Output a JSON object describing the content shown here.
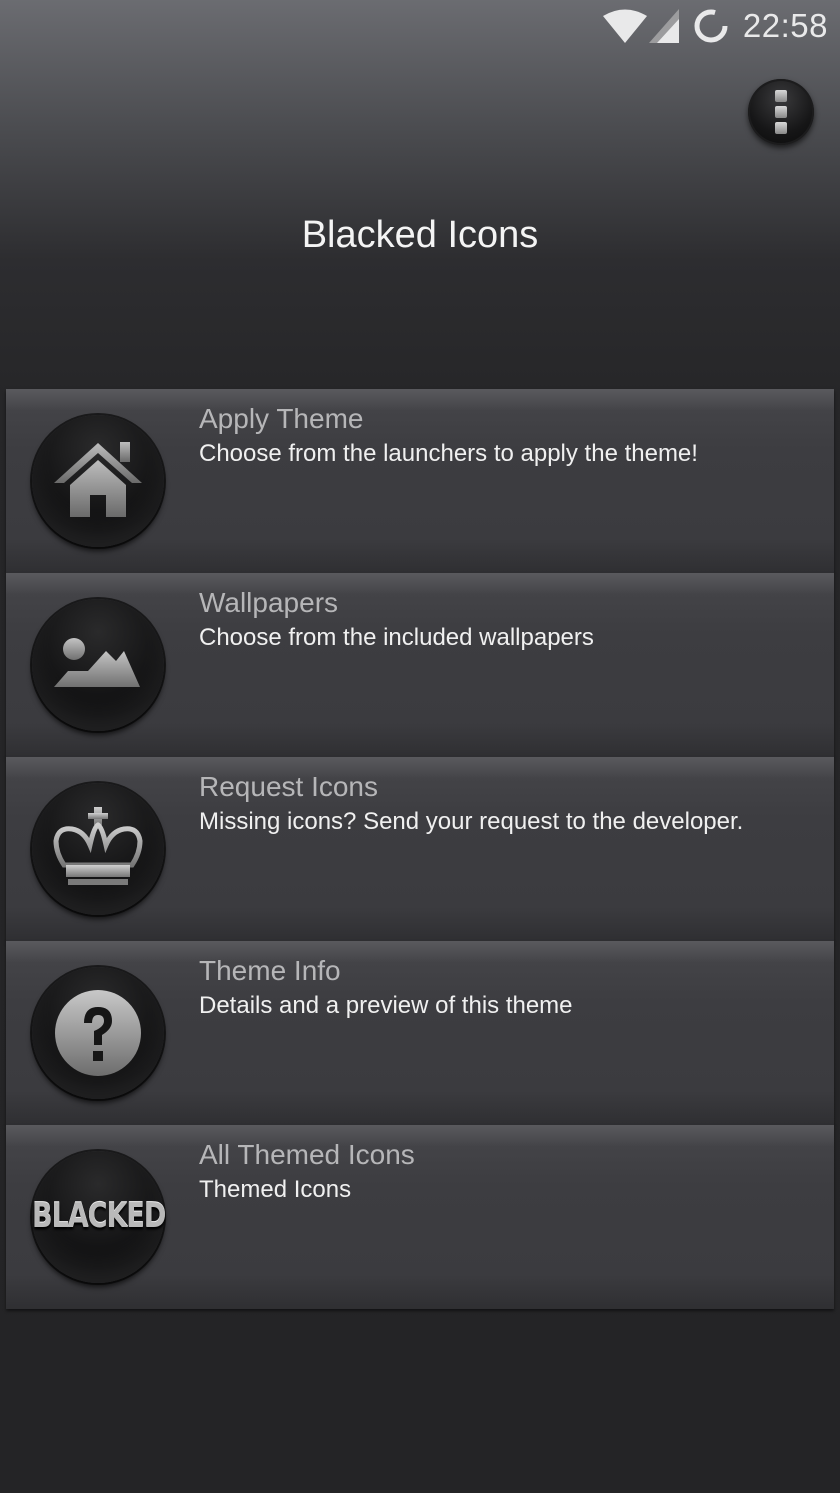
{
  "status_bar": {
    "time": "22:58",
    "icons": [
      "wifi-icon",
      "cellular-signal-icon",
      "sync-icon"
    ]
  },
  "header": {
    "title": "Blacked Icons",
    "overflow_icon": "overflow-menu-icon"
  },
  "menu": {
    "items": [
      {
        "title": "Apply Theme",
        "subtitle": "Choose from the launchers to apply the theme!",
        "icon": "home-icon"
      },
      {
        "title": "Wallpapers",
        "subtitle": "Choose from the included wallpapers",
        "icon": "image-icon"
      },
      {
        "title": "Request Icons",
        "subtitle": "Missing icons? Send your request to the developer.",
        "icon": "crown-icon"
      },
      {
        "title": "Theme Info",
        "subtitle": "Details and a preview of this theme",
        "icon": "question-icon"
      },
      {
        "title": "All Themed Icons",
        "subtitle": "Themed Icons",
        "icon": "blacked-logo-icon",
        "logo_text": "BLACKED"
      }
    ]
  },
  "colors": {
    "background_top": "#6b6c71",
    "background_bottom": "#242426",
    "card": "#3b3b3f",
    "title_text": "#b6b6b8",
    "subtitle_text": "#f0f0f0"
  }
}
